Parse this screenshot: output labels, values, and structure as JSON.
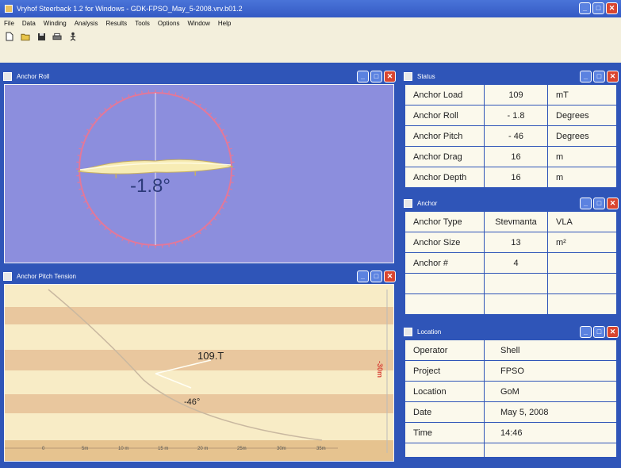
{
  "window": {
    "title": "Vryhof Steerback 1.2 for Windows - GDK-FPSO_May_5-2008.vrv.b01.2"
  },
  "menu": {
    "items": [
      "File",
      "Data",
      "Winding",
      "Analysis",
      "Results",
      "Tools",
      "Options",
      "Window",
      "Help"
    ]
  },
  "toolbar": {
    "icons": [
      "new-file-icon",
      "open-folder-icon",
      "save-icon",
      "print-icon",
      "anchor-person-icon"
    ]
  },
  "panels": {
    "anchor_roll": {
      "title": "Anchor Roll",
      "readout": "-1.8°"
    },
    "pitch_tension": {
      "title": "Anchor Pitch Tension",
      "tension": "109.T",
      "pitch": "-46°",
      "side_scale": "-30m",
      "x_ticks": [
        "0",
        "5m",
        "10 m",
        "15 m",
        "20 m",
        "25m",
        "30m",
        "35m"
      ]
    },
    "status": {
      "title": "Status",
      "rows": [
        {
          "label": "Anchor Load",
          "value": "109",
          "unit": "mT"
        },
        {
          "label": "Anchor Roll",
          "value": "- 1.8",
          "unit": "Degrees"
        },
        {
          "label": "Anchor Pitch",
          "value": "- 46",
          "unit": "Degrees"
        },
        {
          "label": "Anchor Drag",
          "value": "16",
          "unit": "m"
        },
        {
          "label": "Anchor Depth",
          "value": "16",
          "unit": "m"
        }
      ]
    },
    "anchor": {
      "title": "Anchor",
      "rows": [
        {
          "label": "Anchor Type",
          "value": "Stevmanta",
          "unit": "VLA"
        },
        {
          "label": "Anchor Size",
          "value": "13",
          "unit": "m²"
        },
        {
          "label": "Anchor #",
          "value": "4",
          "unit": ""
        },
        {
          "label": "",
          "value": "",
          "unit": ""
        },
        {
          "label": "",
          "value": "",
          "unit": ""
        }
      ]
    },
    "location": {
      "title": "Location",
      "rows": [
        {
          "label": "Operator",
          "value": "Shell"
        },
        {
          "label": "Project",
          "value": "FPSO"
        },
        {
          "label": "Location",
          "value": "GoM"
        },
        {
          "label": "Date",
          "value": "May 5, 2008"
        },
        {
          "label": "Time",
          "value": "14:46"
        },
        {
          "label": "",
          "value": ""
        }
      ]
    }
  },
  "colors": {
    "frame": "#2f55b8",
    "roll_bg": "#8c8edd",
    "dial": "#e2789a",
    "tension_band_light": "#f8ecc6",
    "tension_band_dark": "#e9c79e"
  }
}
